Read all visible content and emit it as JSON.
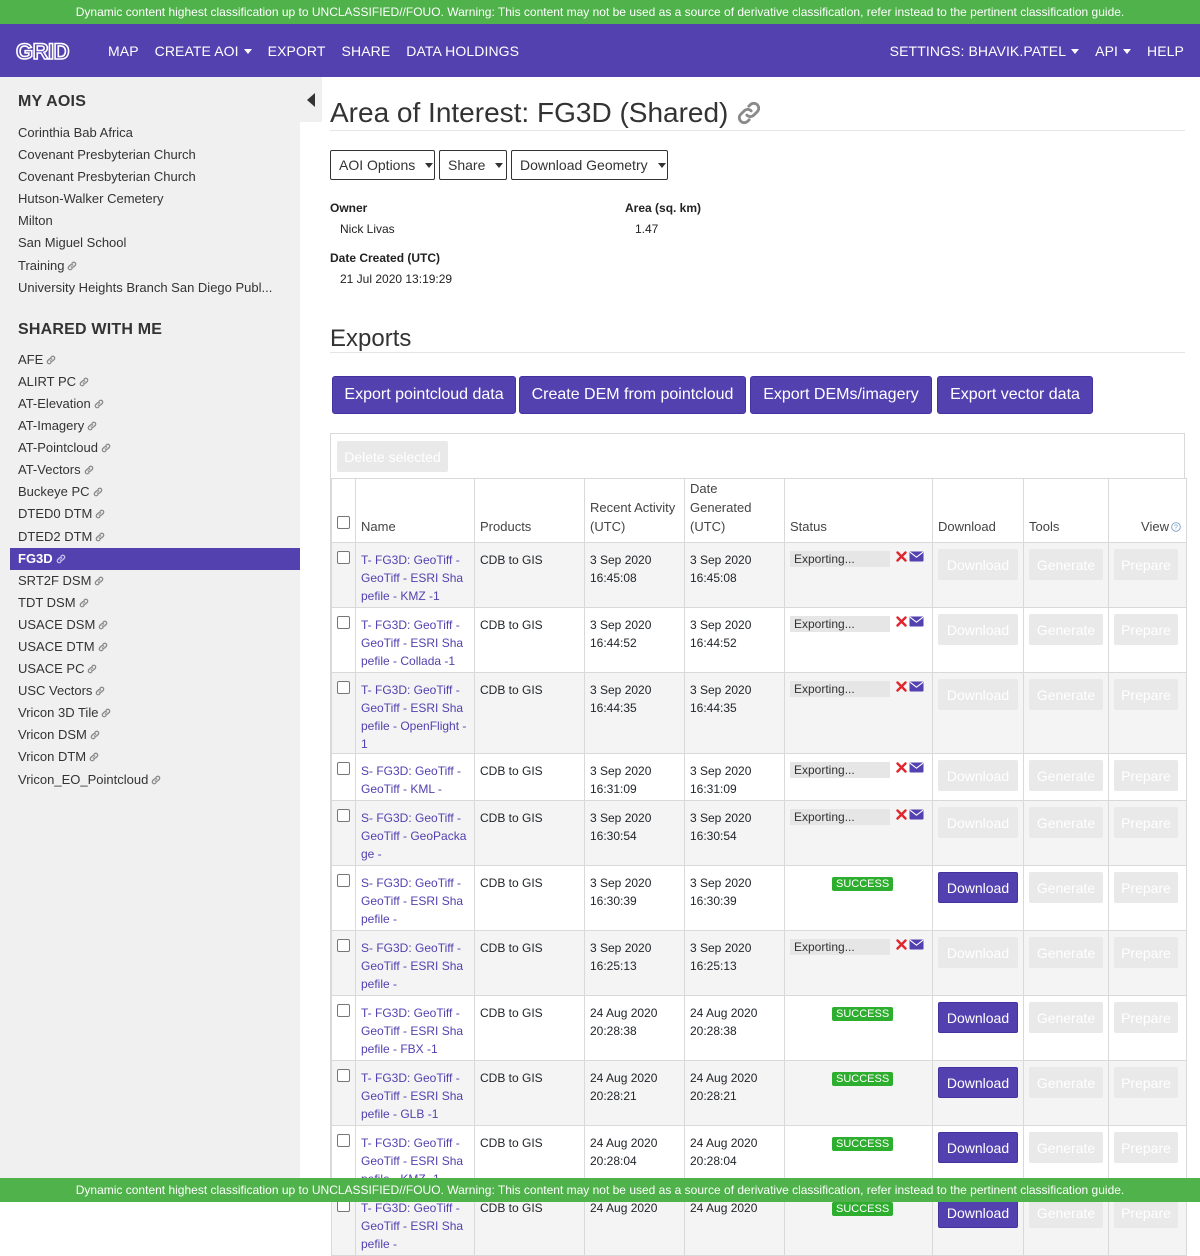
{
  "banner": "Dynamic content highest classification up to UNCLASSIFIED//FOUO. Warning: This content may not be used as a source of derivative classification, refer instead to the pertinent classification guide.",
  "nav": {
    "logo": "GRID",
    "items": [
      "MAP",
      "CREATE AOI",
      "EXPORT",
      "SHARE",
      "DATA HOLDINGS"
    ],
    "right": [
      "SETTINGS: BHAVIK.PATEL",
      "API",
      "HELP"
    ]
  },
  "sidebar": {
    "my_aois_heading": "MY AOIS",
    "my_aois": [
      {
        "label": "Corinthia Bab Africa",
        "shared": false
      },
      {
        "label": "Covenant Presbyterian Church",
        "shared": false
      },
      {
        "label": "Covenant Presbyterian Church",
        "shared": false
      },
      {
        "label": "Hutson-Walker Cemetery",
        "shared": false
      },
      {
        "label": "Milton",
        "shared": false
      },
      {
        "label": "San Miguel School",
        "shared": false
      },
      {
        "label": "Training",
        "shared": true
      },
      {
        "label": "University Heights Branch San Diego Publ...",
        "shared": false
      }
    ],
    "shared_heading": "SHARED WITH ME",
    "shared": [
      {
        "label": "AFE",
        "active": false
      },
      {
        "label": "ALIRT PC",
        "active": false
      },
      {
        "label": "AT-Elevation",
        "active": false
      },
      {
        "label": "AT-Imagery",
        "active": false
      },
      {
        "label": "AT-Pointcloud",
        "active": false
      },
      {
        "label": "AT-Vectors",
        "active": false
      },
      {
        "label": "Buckeye PC",
        "active": false
      },
      {
        "label": "DTED0 DTM",
        "active": false
      },
      {
        "label": "DTED2 DTM",
        "active": false
      },
      {
        "label": "FG3D",
        "active": true
      },
      {
        "label": "SRT2F DSM",
        "active": false
      },
      {
        "label": "TDT DSM",
        "active": false
      },
      {
        "label": "USACE DSM",
        "active": false
      },
      {
        "label": "USACE DTM",
        "active": false
      },
      {
        "label": "USACE PC",
        "active": false
      },
      {
        "label": "USC Vectors",
        "active": false
      },
      {
        "label": "Vricon 3D Tile",
        "active": false
      },
      {
        "label": "Vricon DSM",
        "active": false
      },
      {
        "label": "Vricon DTM",
        "active": false
      },
      {
        "label": "Vricon_EO_Pointcloud",
        "active": false
      }
    ]
  },
  "aoi": {
    "title": "Area of Interest: FG3D (Shared)",
    "buttons": [
      "AOI Options",
      "Share",
      "Download Geometry"
    ],
    "owner_label": "Owner",
    "owner": "Nick Livas",
    "area_label": "Area (sq. km)",
    "area": "1.47",
    "date_label": "Date Created (UTC)",
    "date": "21 Jul 2020 13:19:29"
  },
  "exports": {
    "heading": "Exports",
    "buttons": [
      "Export pointcloud data",
      "Create DEM from pointcloud",
      "Export DEMs/imagery",
      "Export vector data"
    ],
    "delete_label": "Delete selected",
    "columns": [
      "Name",
      "Products",
      "Recent Activity (UTC)",
      "Date Generated (UTC)",
      "Status",
      "Download",
      "Tools",
      "View"
    ],
    "rows": [
      {
        "name": "T- FG3D: GeoTiff - GeoTiff - ESRI Shapefile - KMZ -1",
        "product": "CDB to GIS",
        "activity_date": "3 Sep 2020",
        "activity_time": "16:45:08",
        "gen_date": "3 Sep 2020",
        "gen_time": "16:45:08",
        "status": "Exporting...",
        "success": false
      },
      {
        "name": "T- FG3D: GeoTiff - GeoTiff - ESRI Shapefile - Collada -1",
        "product": "CDB to GIS",
        "activity_date": "3 Sep 2020",
        "activity_time": "16:44:52",
        "gen_date": "3 Sep 2020",
        "gen_time": "16:44:52",
        "status": "Exporting...",
        "success": false
      },
      {
        "name": "T- FG3D: GeoTiff - GeoTiff - ESRI Shapefile - OpenFlight -1",
        "product": "CDB to GIS",
        "activity_date": "3 Sep 2020",
        "activity_time": "16:44:35",
        "gen_date": "3 Sep 2020",
        "gen_time": "16:44:35",
        "status": "Exporting...",
        "success": false
      },
      {
        "name": "S- FG3D: GeoTiff - GeoTiff - KML -",
        "product": "CDB to GIS",
        "activity_date": "3 Sep 2020",
        "activity_time": "16:31:09",
        "gen_date": "3 Sep 2020",
        "gen_time": "16:31:09",
        "status": "Exporting...",
        "success": false
      },
      {
        "name": "S- FG3D: GeoTiff - GeoTiff - GeoPackage -",
        "product": "CDB to GIS",
        "activity_date": "3 Sep 2020",
        "activity_time": "16:30:54",
        "gen_date": "3 Sep 2020",
        "gen_time": "16:30:54",
        "status": "Exporting...",
        "success": false
      },
      {
        "name": "S- FG3D: GeoTiff - GeoTiff - ESRI Shapefile -",
        "product": "CDB to GIS",
        "activity_date": "3 Sep 2020",
        "activity_time": "16:30:39",
        "gen_date": "3 Sep 2020",
        "gen_time": "16:30:39",
        "status": "SUCCESS",
        "success": true
      },
      {
        "name": "S- FG3D: GeoTiff - GeoTiff - ESRI Shapefile -",
        "product": "CDB to GIS",
        "activity_date": "3 Sep 2020",
        "activity_time": "16:25:13",
        "gen_date": "3 Sep 2020",
        "gen_time": "16:25:13",
        "status": "Exporting...",
        "success": false
      },
      {
        "name": "T- FG3D: GeoTiff - GeoTiff - ESRI Shapefile - FBX -1",
        "product": "CDB to GIS",
        "activity_date": "24 Aug 2020",
        "activity_time": "20:28:38",
        "gen_date": "24 Aug 2020",
        "gen_time": "20:28:38",
        "status": "SUCCESS",
        "success": true
      },
      {
        "name": "T- FG3D: GeoTiff - GeoTiff - ESRI Shapefile - GLB -1",
        "product": "CDB to GIS",
        "activity_date": "24 Aug 2020",
        "activity_time": "20:28:21",
        "gen_date": "24 Aug 2020",
        "gen_time": "20:28:21",
        "status": "SUCCESS",
        "success": true
      },
      {
        "name": "T- FG3D: GeoTiff - GeoTiff - ESRI Shapefile - KMZ -1",
        "product": "CDB to GIS",
        "activity_date": "24 Aug 2020",
        "activity_time": "20:28:04",
        "gen_date": "24 Aug 2020",
        "gen_time": "20:28:04",
        "status": "SUCCESS",
        "success": true
      },
      {
        "name": "T- FG3D: GeoTiff - GeoTiff - ESRI Shapefile -",
        "product": "CDB to GIS",
        "activity_date": "24 Aug 2020",
        "activity_time": "",
        "gen_date": "24 Aug 2020",
        "gen_time": "",
        "status": "SUCCESS",
        "success": true
      }
    ],
    "download_label": "Download",
    "generate_label": "Generate",
    "prepare_label": "Prepare"
  },
  "colors": {
    "brand": "#5341b0",
    "banner": "#4fb24a",
    "success": "#2eae2e",
    "cancel": "#e0262f"
  },
  "icons": [
    "link-icon",
    "cancel-x-icon",
    "email-icon",
    "help-icon",
    "collapse-left-icon"
  ]
}
